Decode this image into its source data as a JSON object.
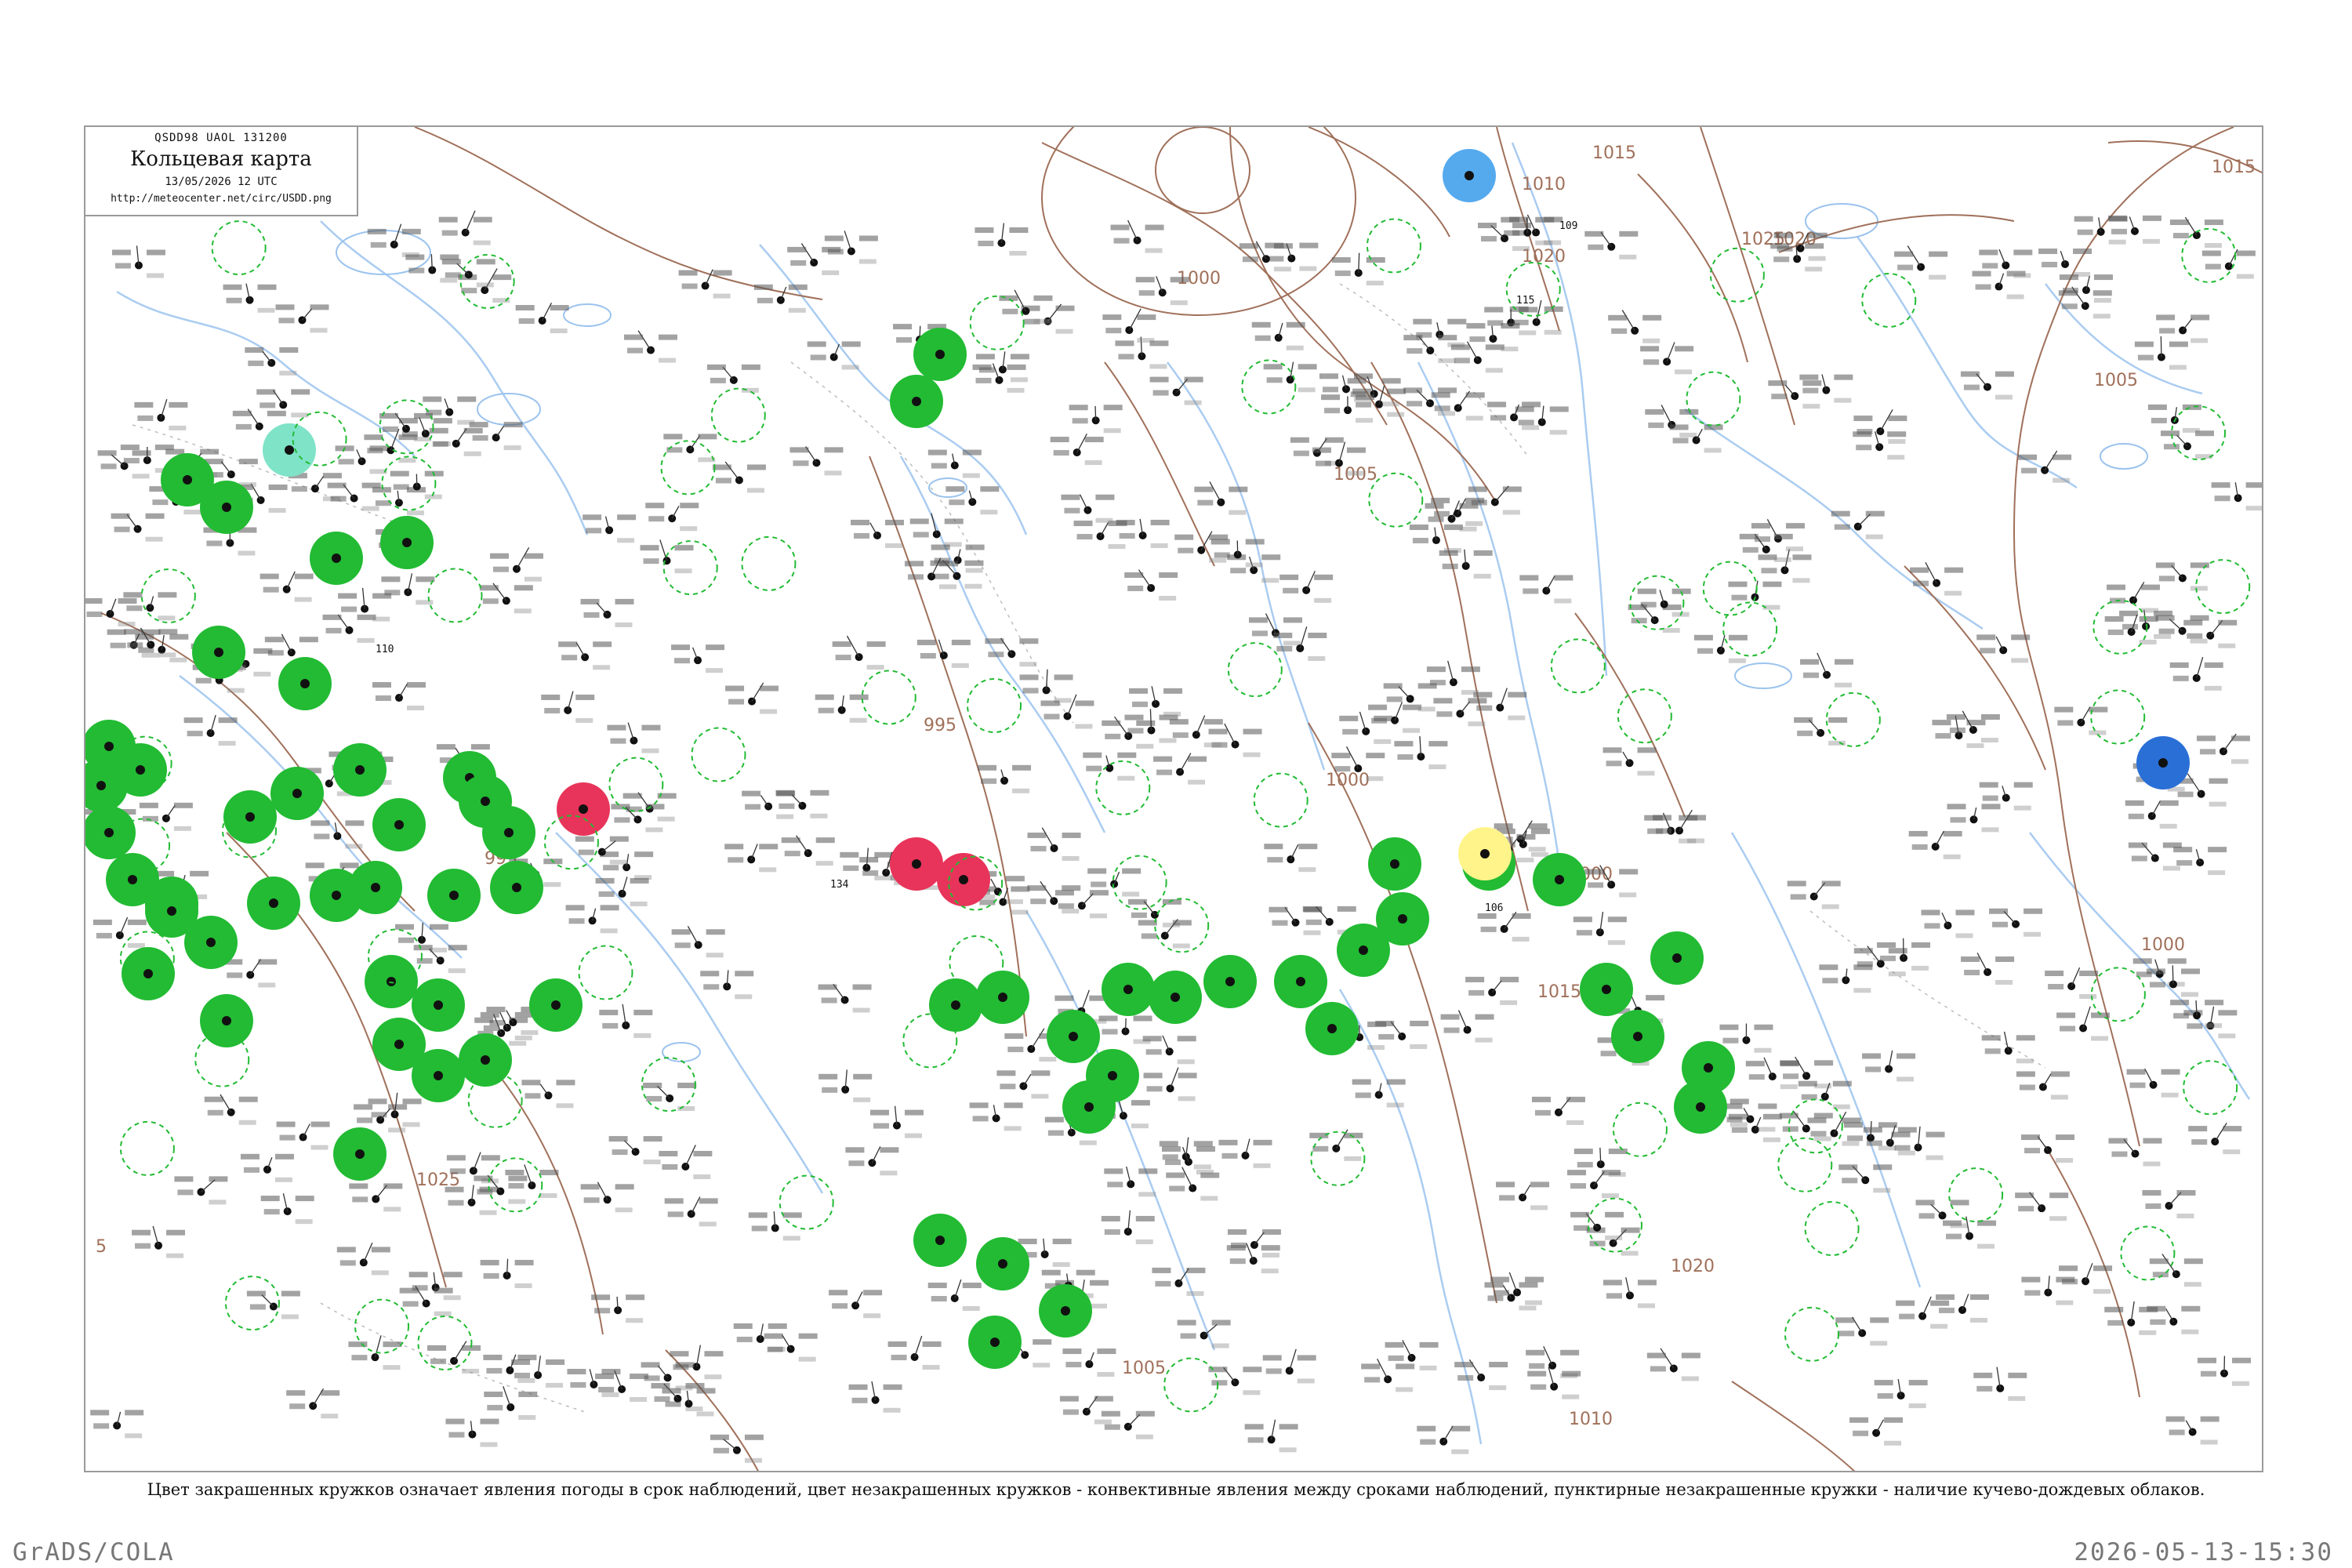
{
  "header": {
    "codes": "QSDD98  UAOL  131200",
    "title": "Кольцевая карта",
    "datetime": "13/05/2026 12 UTC",
    "url": "http://meteocenter.net/circ/USDD.png"
  },
  "isobars": [
    "1015",
    "1015",
    "1010",
    "1005",
    "1000",
    "1020",
    "1025",
    "1020",
    "1005",
    "1010",
    "995",
    "1000",
    "1000",
    "1020",
    "1025",
    "1015",
    "1020",
    "1000",
    "1005",
    "1010",
    "5",
    "995"
  ],
  "station_marks": [
    {
      "label": "110",
      "weather": "rain"
    },
    {
      "label": "134",
      "weather": "rain"
    },
    {
      "label": "106",
      "weather": "thunder"
    },
    {
      "label": "115",
      "weather": "snow"
    },
    {
      "label": "109",
      "weather": "rain"
    }
  ],
  "legend": {
    "text": "Цвет закрашенных кружков означает явления погоды в срок наблюдений, цвет незакрашенных кружков - конвективные явления между сроками наблюдений, пунктирные незакрашенные кружки - наличие кучево-дождевых облаков."
  },
  "footer": {
    "left": "GrADS/COLA",
    "right": "2026-05-13-15:30"
  },
  "colors": {
    "rain": "#22bb33",
    "thunder": "#e8345a",
    "snow": "#55aaee",
    "drizzle": "#7fe3c8",
    "fog": "#fff48a",
    "heavy_snow": "#2a6fd6",
    "isobar": "#a0705a",
    "water": "#9bc3ee"
  }
}
